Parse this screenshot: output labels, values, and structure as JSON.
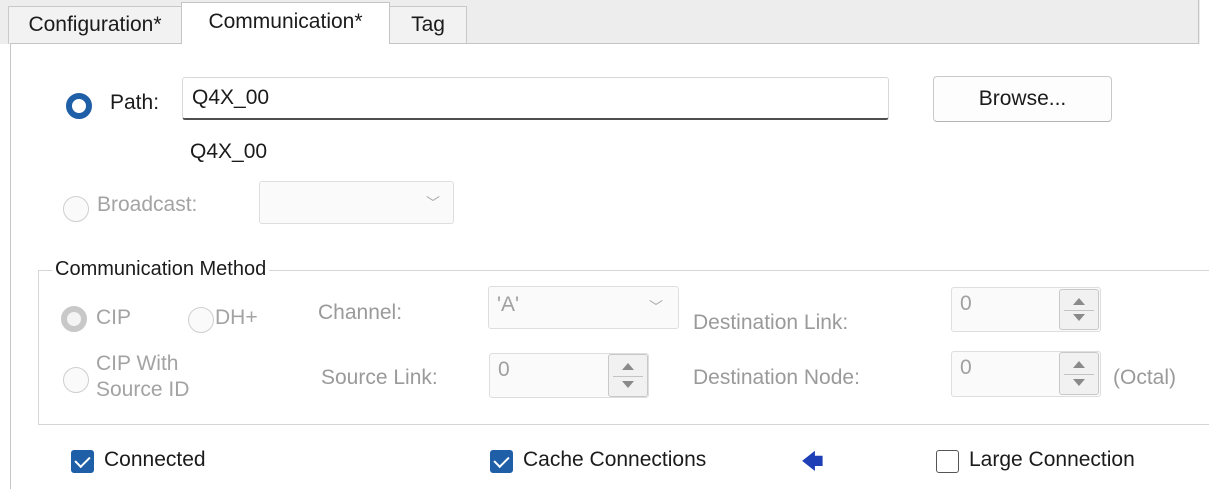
{
  "tabs": [
    {
      "label": "Configuration*",
      "active": false
    },
    {
      "label": "Communication*",
      "active": true
    },
    {
      "label": "Tag",
      "active": false
    }
  ],
  "path": {
    "radio_label": "Path:",
    "value": "Q4X_00",
    "resolved": "Q4X_00",
    "browse_label": "Browse..."
  },
  "broadcast": {
    "radio_label": "Broadcast:",
    "selected": ""
  },
  "comm_method": {
    "title": "Communication Method",
    "options": {
      "cip": "CIP",
      "dhplus": "DH+",
      "cip_source_id": "CIP With Source ID",
      "cip_source_id_line1": "CIP With",
      "cip_source_id_line2": "Source ID"
    },
    "channel_label": "Channel:",
    "channel_value": "'A'",
    "dest_link_label": "Destination Link:",
    "dest_link_value": "0",
    "source_link_label": "Source Link:",
    "source_link_value": "0",
    "dest_node_label": "Destination Node:",
    "dest_node_value": "0",
    "octal_label": "(Octal)"
  },
  "checkboxes": {
    "connected": {
      "label": "Connected",
      "checked": true
    },
    "cache_connections": {
      "label": "Cache Connections",
      "checked": true
    },
    "large_connection": {
      "label": "Large Connection",
      "checked": false
    }
  },
  "icons": {
    "cache_arrow": "left-arrow-icon"
  },
  "colors": {
    "accent": "#1f5fa8",
    "arrow": "#1f3fb6"
  }
}
